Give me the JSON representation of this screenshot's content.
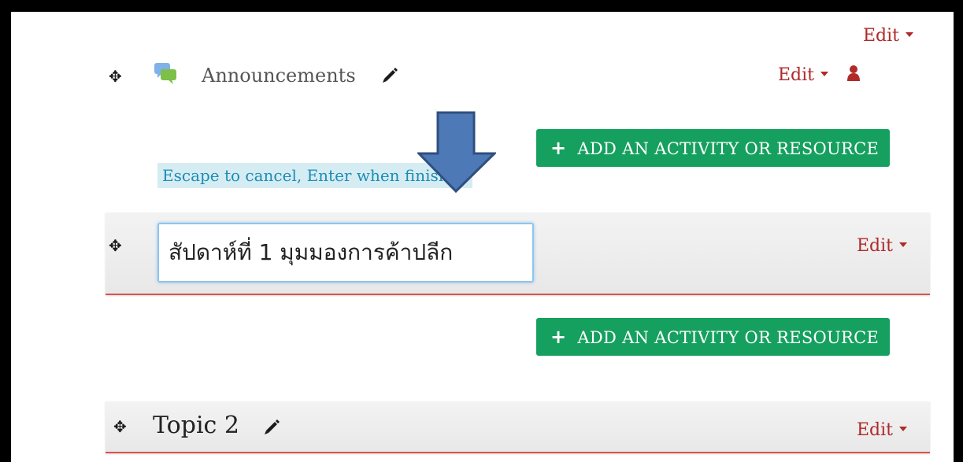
{
  "top_edit": {
    "label": "Edit"
  },
  "activity": {
    "name": "Announcements",
    "edit_label": "Edit",
    "icon": "forum-chat-bubbles",
    "role_icon": "person-icon"
  },
  "add_activity_label": "ADD AN ACTIVITY OR RESOURCE",
  "hint": {
    "text": "Escape to cancel, Enter when finished"
  },
  "section1": {
    "input_value": "สัปดาห์ที่ 1 มุมมองการค้าปลีก",
    "edit_label": "Edit"
  },
  "section2": {
    "title": "Topic 2",
    "edit_label": "Edit"
  },
  "colors": {
    "edit": "#b02a2a",
    "add_button": "#16a05f",
    "hint_bg": "#d6ecf3",
    "hint_text": "#1b8db5",
    "section_border": "#d9534f",
    "arrow": "#4e79b7"
  }
}
